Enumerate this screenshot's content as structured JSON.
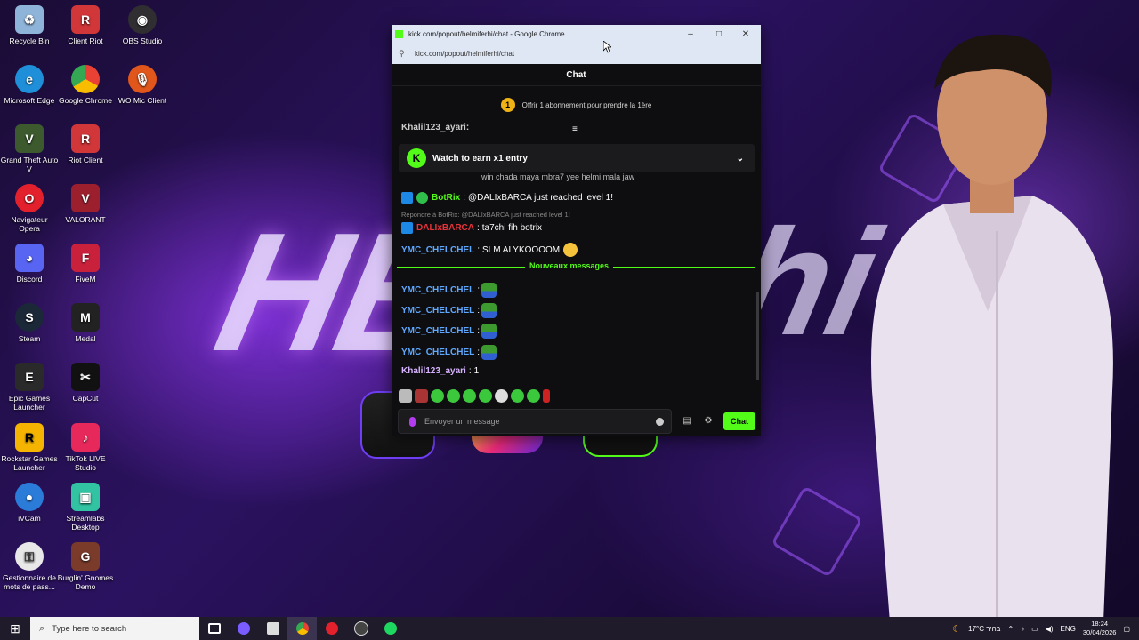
{
  "desktop": {
    "icons": [
      {
        "label": "Recycle Bin",
        "color": "#8fb4d9"
      },
      {
        "label": "Client Riot",
        "color": "#d13639"
      },
      {
        "label": "OBS Studio",
        "color": "#302e31"
      },
      {
        "label": "Microsoft Edge",
        "color": "#1e8fd8"
      },
      {
        "label": "Google Chrome",
        "color": "#e94235"
      },
      {
        "label": "WO Mic Client",
        "color": "#e0561b"
      },
      {
        "label": "Grand Theft Auto V",
        "color": "#3c5a2e"
      },
      {
        "label": "Riot Client",
        "color": "#d13639"
      },
      {
        "label": "Navigateur Opera",
        "color": "#e3212d"
      },
      {
        "label": "VALORANT",
        "color": "#9c1f2e"
      },
      {
        "label": "Discord",
        "color": "#5865f2"
      },
      {
        "label": "FiveM",
        "color": "#c9213c"
      },
      {
        "label": "Steam",
        "color": "#1b2838"
      },
      {
        "label": "Medal",
        "color": "#222222"
      },
      {
        "label": "Epic Games Launcher",
        "color": "#2a2a2a"
      },
      {
        "label": "CapCut",
        "color": "#111111"
      },
      {
        "label": "Rockstar Games Launcher",
        "color": "#f4b400"
      },
      {
        "label": "TikTok LIVE Studio",
        "color": "#e6285a"
      },
      {
        "label": "iVCam",
        "color": "#2b7bd9"
      },
      {
        "label": "Streamlabs Desktop",
        "color": "#31c3a2"
      },
      {
        "label": "Gestionnaire de mots de pass...",
        "color": "#e8e8e8"
      },
      {
        "label": "Burglin' Gnomes Demo",
        "color": "#7a3b2a"
      }
    ]
  },
  "browser": {
    "title": "kick.com/popout/helmiferhi/chat - Google Chrome",
    "url": "kick.com/popout/helmiferhi/chat",
    "controls": {
      "minimize": "–",
      "maximize": "□",
      "close": "✕"
    }
  },
  "chat": {
    "header": "Chat",
    "subs_count": "1",
    "subs_text": "Offrir 1 abonnement pour prendre la 1ère",
    "earn_banner": "Watch to earn x1 entry",
    "partial_top_user": "Khalil123_ayari:",
    "partial_msg": "win chada maya mbra7 yee helmi mala jaw",
    "messages": [
      {
        "user": "BotRix",
        "user_color": "#53fc18",
        "text": "@DALIxBARCA just reached level 1!"
      },
      {
        "reply_hint": "Répondre à BotRix: @DALIxBARCA just reached level 1!"
      },
      {
        "user": "DALIxBARCA",
        "user_color": "#e8333a",
        "text": "ta7chi fih botrix"
      },
      {
        "user": "YMC_CHELCHEL",
        "user_color": "#5fa8ff",
        "text": "SLM ALYKOOOOM"
      }
    ],
    "new_messages_label": "Nouveaux messages",
    "recent": [
      {
        "user": "YMC_CHELCHEL",
        "user_color": "#5fa8ff"
      },
      {
        "user": "YMC_CHELCHEL",
        "user_color": "#5fa8ff"
      },
      {
        "user": "YMC_CHELCHEL",
        "user_color": "#5fa8ff"
      },
      {
        "user": "YMC_CHELCHEL",
        "user_color": "#5fa8ff"
      },
      {
        "user": "Khalil123_ayari",
        "user_color": "#d7b3ff",
        "text": "1"
      }
    ],
    "input_placeholder": "Envoyer un message",
    "send_label": "Chat",
    "accent": "#53fc18"
  },
  "taskbar": {
    "search_placeholder": "Type here to search",
    "weather": "17°C בהיר",
    "lang": "ENG",
    "time": "18:24",
    "date": "30/04/2026"
  }
}
